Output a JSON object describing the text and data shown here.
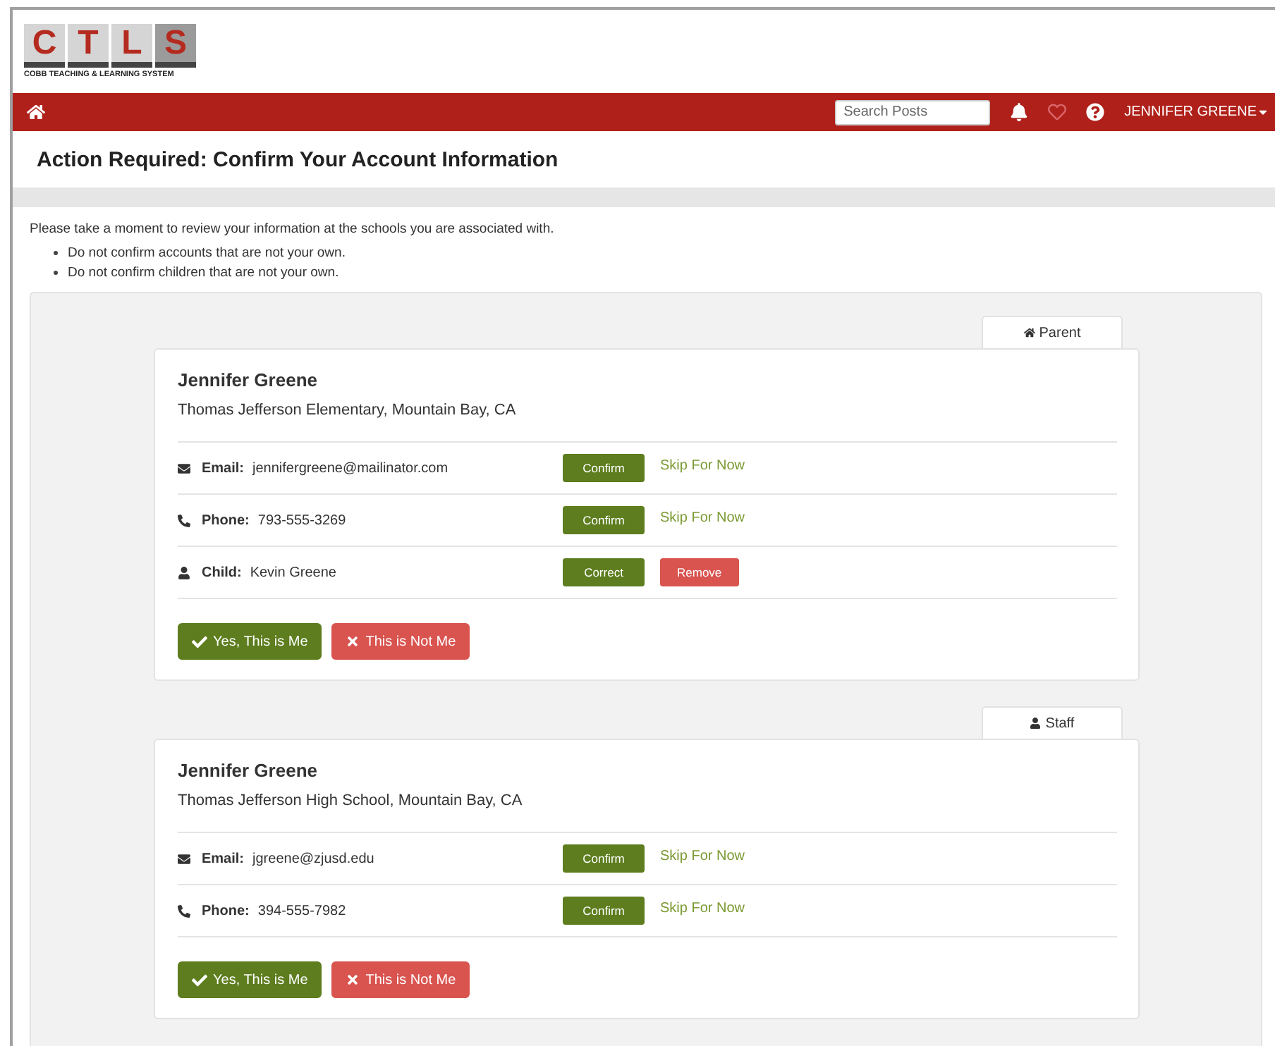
{
  "logo": {
    "letters": [
      "C",
      "T",
      "L",
      "S"
    ],
    "tagline": "COBB TEACHING & LEARNING SYSTEM"
  },
  "navbar": {
    "search": {
      "placeholder": "Search Posts"
    },
    "user": "JENNIFER GREENE"
  },
  "page_title": "Action Required: Confirm Your Account Information",
  "intro": "Please take a moment to review your information at the schools you are associated with.",
  "notes": [
    "Do not confirm accounts that are not your own.",
    "Do not confirm children that are not your own."
  ],
  "accounts": [
    {
      "tab": {
        "kind": "parent",
        "label": "Parent"
      },
      "name": "Jennifer Greene",
      "school": "Thomas Jefferson Elementary, Mountain Bay, CA",
      "rows": [
        {
          "kind": "email",
          "label": "Email:",
          "value": "jennifergreene@mailinator.com",
          "actions": [
            {
              "kind": "primary",
              "label": "Confirm"
            },
            {
              "kind": "link",
              "label": "Skip For Now"
            }
          ]
        },
        {
          "kind": "phone",
          "label": "Phone:",
          "value": "793-555-3269",
          "actions": [
            {
              "kind": "primary",
              "label": "Confirm"
            },
            {
              "kind": "link",
              "label": "Skip For Now"
            }
          ]
        },
        {
          "kind": "child",
          "label": "Child:",
          "value": "Kevin Greene",
          "actions": [
            {
              "kind": "primary",
              "label": "Correct"
            },
            {
              "kind": "danger",
              "label": "Remove"
            }
          ]
        }
      ],
      "buttons": [
        {
          "kind": "yes",
          "label": "Yes, This is Me"
        },
        {
          "kind": "no",
          "label": "This is Not Me"
        }
      ]
    },
    {
      "tab": {
        "kind": "staff",
        "label": "Staff"
      },
      "name": "Jennifer Greene",
      "school": "Thomas Jefferson High School, Mountain Bay, CA",
      "rows": [
        {
          "kind": "email",
          "label": "Email:",
          "value": "jgreene@zjusd.edu",
          "actions": [
            {
              "kind": "primary",
              "label": "Confirm"
            },
            {
              "kind": "link",
              "label": "Skip For Now"
            }
          ]
        },
        {
          "kind": "phone",
          "label": "Phone:",
          "value": "394-555-7982",
          "actions": [
            {
              "kind": "primary",
              "label": "Confirm"
            },
            {
              "kind": "link",
              "label": "Skip For Now"
            }
          ]
        }
      ],
      "buttons": [
        {
          "kind": "yes",
          "label": "Yes, This is Me"
        },
        {
          "kind": "no",
          "label": "This is Not Me"
        }
      ]
    }
  ]
}
